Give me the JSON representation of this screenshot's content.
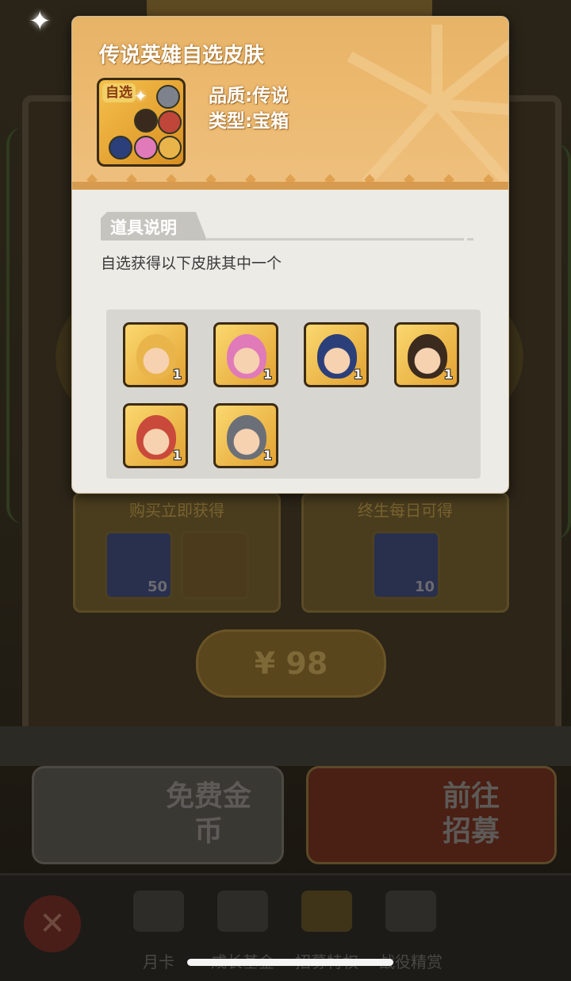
{
  "popup": {
    "title": "传说英雄自选皮肤",
    "item_tag": "自选",
    "quality_line": "品质:传说",
    "type_line": "类型:宝箱",
    "section_title": "道具说明",
    "description": "自选获得以下皮肤其中一个",
    "skins": [
      {
        "icon": "yellow-cap-hero-skin-icon",
        "count": "1",
        "color": "#e9b44a"
      },
      {
        "icon": "pink-hair-hero-skin-icon",
        "count": "1",
        "color": "#e07ab8"
      },
      {
        "icon": "blue-empress-hero-skin-icon",
        "count": "1",
        "color": "#2b3f7a"
      },
      {
        "icon": "dark-hair-hero-skin-icon",
        "count": "1",
        "color": "#3b2a1e"
      },
      {
        "icon": "pirate-clown-hero-skin-icon",
        "count": "1",
        "color": "#c94a3a"
      },
      {
        "icon": "armored-knight-hero-skin-icon",
        "count": "1",
        "color": "#6b6f78"
      }
    ]
  },
  "background": {
    "card_left_title": "购买立即获得",
    "card_right_title": "终生每日可得",
    "item_count_left": "50",
    "item_count_right": "10",
    "price": "¥ 98",
    "free_coins_label": "免费金币",
    "recruit_label": "前往招募",
    "tabs": [
      "月卡",
      "成长基金",
      "招募特权",
      "战役精赏"
    ]
  }
}
